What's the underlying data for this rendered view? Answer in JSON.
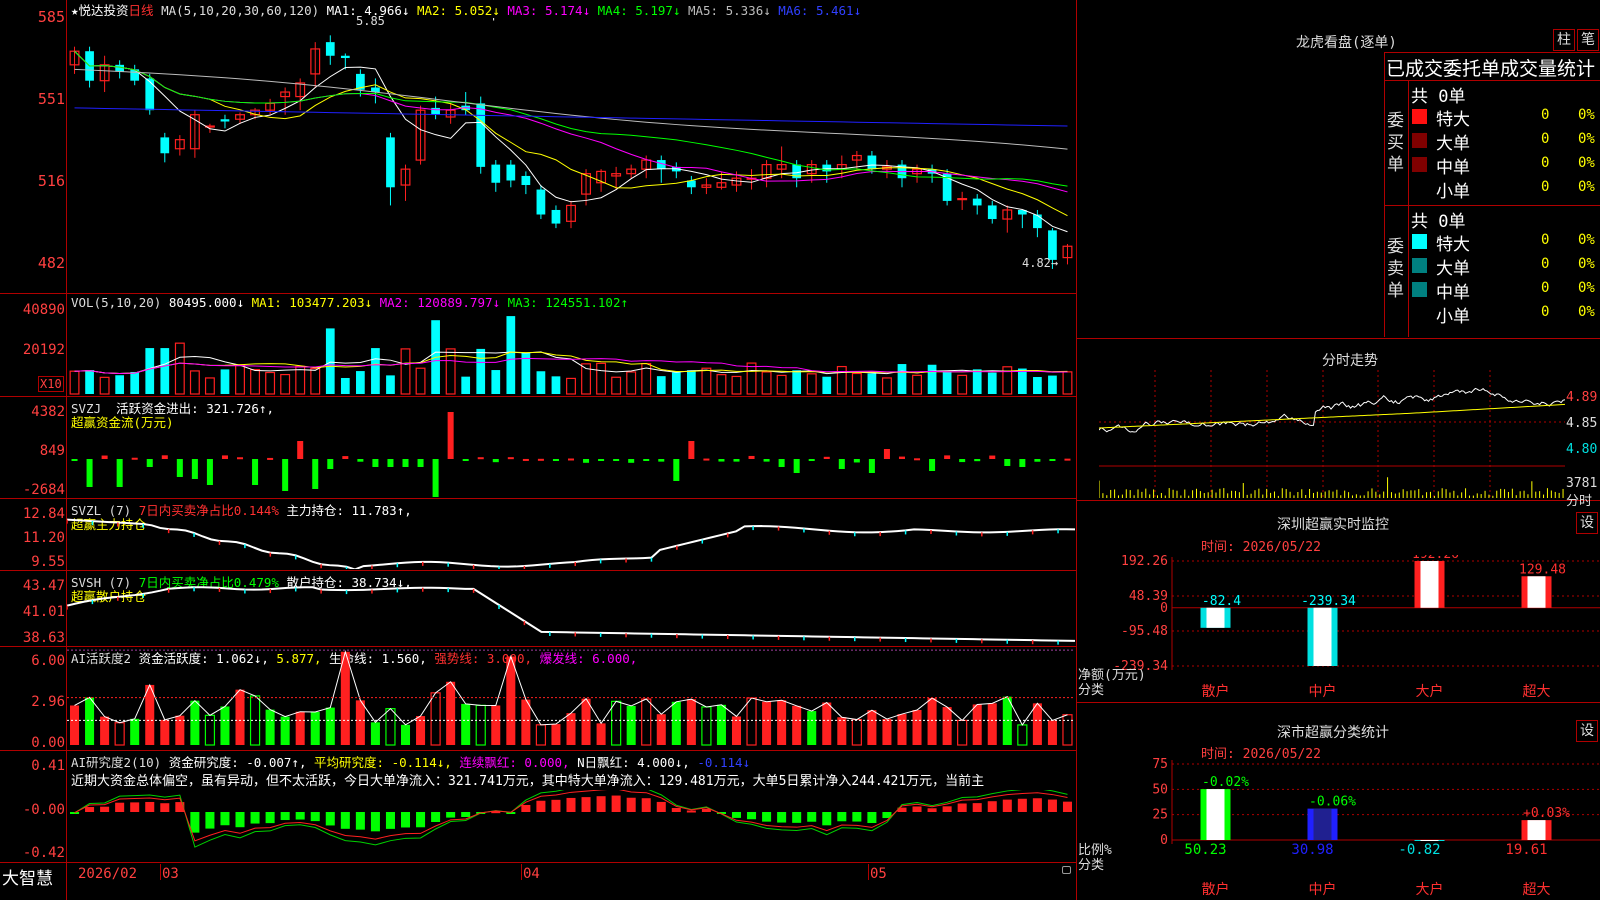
{
  "colors": {
    "up": "#ff2020",
    "down": "#00ffff",
    "ma1": "#ffffff",
    "ma2": "#ffff00",
    "ma3": "#ff00ff",
    "ma4": "#00ff00",
    "ma5": "#bbbbbb",
    "ma6": "#2020ff",
    "grid": "#b00000",
    "axis": "#ff4040"
  },
  "header": {
    "stock_name": "★悦达投资",
    "period": "日线",
    "ma_label": "MA(5,10,20,30,60,120)",
    "ma1_label": "MA1:",
    "ma1": "4.966↓",
    "ma2_label": "MA2:",
    "ma2": "5.052↓",
    "ma3_label": "MA3:",
    "ma3": "5.174↓",
    "ma4_label": "MA4:",
    "ma4": "5.197↓",
    "ma5_label": "MA5:",
    "ma5": "5.336↓",
    "ma6_label": "MA6:",
    "ma6": "5.461↓",
    "high_label": "5.85",
    "low_label": "4.82→"
  },
  "price_axis": [
    "585",
    "551",
    "516",
    "482"
  ],
  "vol": {
    "label": "VOL(5,10,20)",
    "value": "80495.000↓",
    "ma1_label": "MA1:",
    "ma1": "103477.203↓",
    "ma2_label": "MA2:",
    "ma2": "120889.797↓",
    "ma3_label": "MA3:",
    "ma3": "124551.102↑",
    "axis": [
      "40890",
      "20192"
    ],
    "unit": "X10"
  },
  "svzj": {
    "label": "SVZJ",
    "name": "活跃资金进出:",
    "value": "321.726↑,",
    "sub": "超赢资金流(万元)",
    "axis": [
      "4382",
      "849",
      "-2684"
    ]
  },
  "svzl": {
    "label": "SVZL (7)",
    "ratio": "7日内买卖净占比0.144%",
    "name": "主力持仓:",
    "value": "11.783↑,",
    "sub": "超赢主力持仓",
    "axis": [
      "12.84",
      "11.20",
      "9.55"
    ]
  },
  "svsh": {
    "label": "SVSH (7)",
    "ratio": "7日内买卖净占比0.479%",
    "name": "散户持仓:",
    "value": "38.734↓,",
    "sub": "超赢散户持仓",
    "axis": [
      "43.47",
      "41.01",
      "38.63"
    ]
  },
  "ai1": {
    "label": "AI活跃度2",
    "name": "资金活跃度:",
    "value": "1.062↓,",
    "v2": "5.877,",
    "life_label": "生命线:",
    "life": "1.560,",
    "strong": "强势线: 3.000,",
    "burst": "爆发线: 6.000,",
    "axis": [
      "6.00",
      "2.96",
      "0.00"
    ]
  },
  "ai2": {
    "label": "AI研究度2(10)",
    "name": "资金研究度:",
    "value": "-0.007↑,",
    "avg": "平均研究度: -0.114↓,",
    "red": "连续飘红: 0.000,",
    "nred": "N日飘红: 4.000↓,",
    "last": "-0.114↓",
    "axis": [
      "0.41",
      "-0.00",
      "-0.42"
    ],
    "comment": "近期大资金总体偏空，虽有异动，但不太活跃，今日大单净流入：321.741万元，其中特大单净流入：129.481万元，大单5日累计净入244.421万元，当前主"
  },
  "footer": {
    "brand": "大智慧",
    "dates": [
      "2026/02",
      "03",
      "04",
      "05"
    ]
  },
  "dragon": {
    "title": "龙虎看盘(逐单)",
    "btn_bar": "柱",
    "btn_pen": "笔",
    "table_title": "已成交委托单成交量统计",
    "buy_side": "委买单",
    "sell_side": "委卖单",
    "buy_total": "共 0单",
    "sell_total": "共 0单",
    "rows": [
      {
        "label": "特大",
        "count": "0",
        "pct": "0%"
      },
      {
        "label": "大单",
        "count": "0",
        "pct": "0%"
      },
      {
        "label": "中单",
        "count": "0",
        "pct": "0%"
      },
      {
        "label": "小单",
        "count": "0",
        "pct": "0%"
      }
    ]
  },
  "intraday": {
    "title": "分时走势",
    "axis": [
      "4.89",
      "4.85",
      "4.80"
    ],
    "vol_axis": [
      "3781",
      "分时"
    ]
  },
  "monitor": {
    "title": "深圳超赢实时监控",
    "btn": "设",
    "time": "时间: 2026/05/22",
    "yaxis": [
      "192.26",
      "48.39",
      "0",
      "-95.48",
      "-239.34"
    ],
    "ylabel": "净额(万元)",
    "xlabel": "分类"
  },
  "stats": {
    "title": "深市超赢分类统计",
    "btn": "设",
    "time": "时间: 2026/05/22",
    "yaxis": [
      "75",
      "50",
      "25",
      "0"
    ],
    "ylabel": "比例%",
    "xlabel": "分类"
  },
  "chart_data": [
    {
      "type": "bar",
      "title": "深圳超赢实时监控",
      "categories": [
        "散户",
        "中户",
        "大户",
        "超大"
      ],
      "values": [
        -82.4,
        -239.34,
        192.26,
        129.48
      ],
      "ylabel": "净额(万元)",
      "ylim": [
        -239.34,
        192.26
      ]
    },
    {
      "type": "bar",
      "title": "深市超赢分类统计",
      "categories": [
        "散户",
        "中户",
        "大户",
        "超大"
      ],
      "values": [
        50.23,
        30.98,
        -0.82,
        19.61
      ],
      "changes": [
        "-0.02%",
        "-0.06%",
        "",
        "+0.03%"
      ],
      "ylabel": "比例%",
      "ylim": [
        0,
        75
      ]
    },
    {
      "type": "candlestick",
      "title": "悦达投资 日线",
      "ylim": [
        4.82,
        5.85
      ],
      "candles": [
        [
          5.72,
          5.78,
          5.68,
          5.8
        ],
        [
          5.78,
          5.65,
          5.62,
          5.8
        ],
        [
          5.65,
          5.72,
          5.6,
          5.76
        ],
        [
          5.72,
          5.69,
          5.66,
          5.74
        ],
        [
          5.7,
          5.65,
          5.63,
          5.72
        ],
        [
          5.66,
          5.52,
          5.5,
          5.68
        ],
        [
          5.4,
          5.33,
          5.29,
          5.42
        ],
        [
          5.35,
          5.39,
          5.32,
          5.41
        ],
        [
          5.35,
          5.5,
          5.31,
          5.52
        ],
        [
          5.45,
          5.45,
          5.42,
          5.46
        ],
        [
          5.48,
          5.47,
          5.44,
          5.5
        ],
        [
          5.48,
          5.5,
          5.46,
          5.51
        ],
        [
          5.5,
          5.52,
          5.48,
          5.53
        ],
        [
          5.52,
          5.55,
          5.5,
          5.57
        ],
        [
          5.58,
          5.6,
          5.5,
          5.62
        ],
        [
          5.58,
          5.64,
          5.52,
          5.66
        ],
        [
          5.68,
          5.79,
          5.62,
          5.82
        ],
        [
          5.82,
          5.76,
          5.72,
          5.85
        ],
        [
          5.76,
          5.75,
          5.7,
          5.77
        ],
        [
          5.68,
          5.61,
          5.58,
          5.7
        ],
        [
          5.62,
          5.6,
          5.55,
          5.66
        ],
        [
          5.4,
          5.18,
          5.1,
          5.42
        ],
        [
          5.19,
          5.26,
          5.12,
          5.28
        ],
        [
          5.3,
          5.52,
          5.28,
          5.54
        ],
        [
          5.53,
          5.5,
          5.48,
          5.58
        ],
        [
          5.49,
          5.52,
          5.46,
          5.55
        ],
        [
          5.54,
          5.52,
          5.5,
          5.6
        ],
        [
          5.55,
          5.27,
          5.24,
          5.58
        ],
        [
          5.28,
          5.2,
          5.16,
          5.3
        ],
        [
          5.28,
          5.21,
          5.18,
          5.3
        ],
        [
          5.23,
          5.19,
          5.15,
          5.25
        ],
        [
          5.17,
          5.06,
          5.04,
          5.19
        ],
        [
          5.08,
          5.02,
          5.0,
          5.1
        ],
        [
          5.03,
          5.1,
          5.0,
          5.12
        ],
        [
          5.15,
          5.24,
          5.1,
          5.26
        ],
        [
          5.2,
          5.25,
          5.16,
          5.26
        ],
        [
          5.23,
          5.24,
          5.17,
          5.27
        ],
        [
          5.24,
          5.26,
          5.22,
          5.28
        ],
        [
          5.26,
          5.3,
          5.22,
          5.32
        ],
        [
          5.3,
          5.26,
          5.2,
          5.32
        ],
        [
          5.27,
          5.25,
          5.22,
          5.29
        ],
        [
          5.21,
          5.18,
          5.15,
          5.23
        ],
        [
          5.18,
          5.19,
          5.15,
          5.22
        ],
        [
          5.18,
          5.2,
          5.17,
          5.25
        ],
        [
          5.19,
          5.22,
          5.16,
          5.25
        ],
        [
          5.22,
          5.22,
          5.17,
          5.26
        ],
        [
          5.22,
          5.28,
          5.18,
          5.3
        ],
        [
          5.26,
          5.28,
          5.22,
          5.36
        ],
        [
          5.28,
          5.22,
          5.18,
          5.3
        ],
        [
          5.24,
          5.28,
          5.2,
          5.3
        ],
        [
          5.28,
          5.25,
          5.2,
          5.3
        ],
        [
          5.26,
          5.28,
          5.22,
          5.32
        ],
        [
          5.3,
          5.32,
          5.26,
          5.34
        ],
        [
          5.32,
          5.26,
          5.24,
          5.34
        ],
        [
          5.26,
          5.27,
          5.22,
          5.3
        ],
        [
          5.28,
          5.22,
          5.18,
          5.3
        ],
        [
          5.24,
          5.26,
          5.2,
          5.28
        ],
        [
          5.26,
          5.24,
          5.2,
          5.28
        ],
        [
          5.24,
          5.12,
          5.1,
          5.26
        ],
        [
          5.13,
          5.13,
          5.08,
          5.16
        ],
        [
          5.13,
          5.1,
          5.06,
          5.15
        ],
        [
          5.1,
          5.04,
          5.02,
          5.12
        ],
        [
          5.04,
          5.08,
          4.98,
          5.1
        ],
        [
          5.08,
          5.06,
          5.0,
          5.08
        ],
        [
          5.06,
          5.0,
          4.96,
          5.08
        ],
        [
          4.99,
          4.86,
          4.82,
          5.0
        ],
        [
          4.87,
          4.92,
          4.84,
          4.93
        ]
      ]
    }
  ]
}
